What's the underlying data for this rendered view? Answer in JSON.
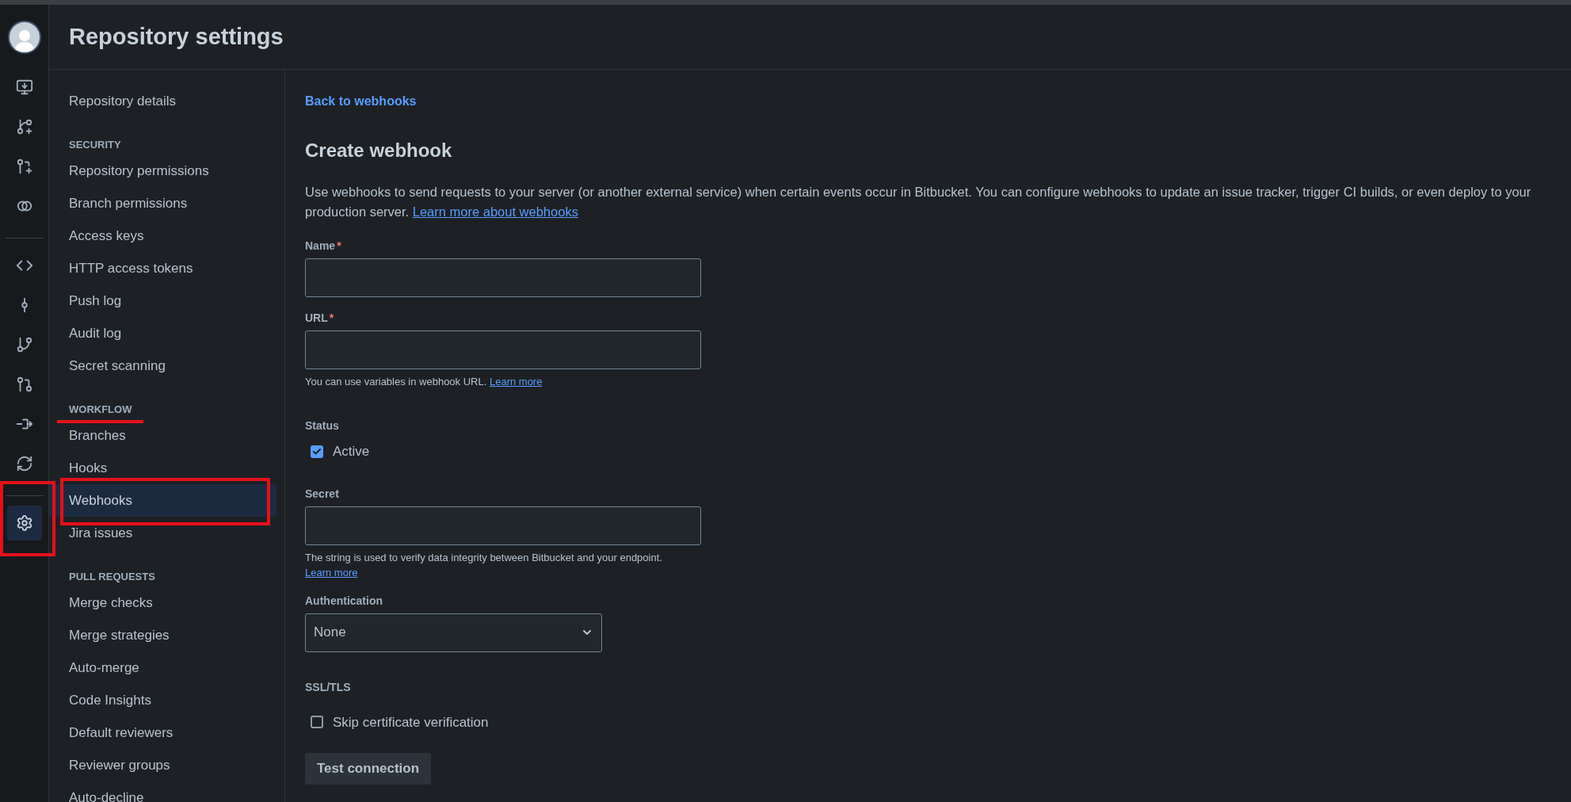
{
  "header": {
    "title": "Repository settings"
  },
  "rail": [
    {
      "selected": false
    },
    {
      "selected": false
    },
    {
      "selected": false
    },
    {
      "selected": false
    },
    {
      "selected": false
    },
    {
      "selected": false
    },
    {
      "selected": false
    },
    {
      "selected": false
    },
    {
      "selected": false
    },
    {
      "selected": false
    },
    {
      "selected": true
    }
  ],
  "sidebar": {
    "groups": [
      {
        "items": [
          {
            "label": "Repository details",
            "selected": false
          }
        ]
      },
      {
        "heading": "SECURITY",
        "items": [
          {
            "label": "Repository permissions",
            "selected": false
          },
          {
            "label": "Branch permissions",
            "selected": false
          },
          {
            "label": "Access keys",
            "selected": false
          },
          {
            "label": "HTTP access tokens",
            "selected": false
          },
          {
            "label": "Push log",
            "selected": false
          },
          {
            "label": "Audit log",
            "selected": false
          },
          {
            "label": "Secret scanning",
            "selected": false
          }
        ]
      },
      {
        "heading": "WORKFLOW",
        "items": [
          {
            "label": "Branches",
            "selected": false
          },
          {
            "label": "Hooks",
            "selected": false
          },
          {
            "label": "Webhooks",
            "selected": true
          },
          {
            "label": "Jira issues",
            "selected": false
          }
        ]
      },
      {
        "heading": "PULL REQUESTS",
        "items": [
          {
            "label": "Merge checks",
            "selected": false
          },
          {
            "label": "Merge strategies",
            "selected": false
          },
          {
            "label": "Auto-merge",
            "selected": false
          },
          {
            "label": "Code Insights",
            "selected": false
          },
          {
            "label": "Default reviewers",
            "selected": false
          },
          {
            "label": "Reviewer groups",
            "selected": false
          },
          {
            "label": "Auto-decline",
            "selected": false
          }
        ]
      }
    ]
  },
  "main": {
    "back_link": "Back to webhooks",
    "title": "Create webhook",
    "description": {
      "text": "Use webhooks to send requests to your server (or another external service) when certain events occur in Bitbucket. You can configure webhooks to update an issue tracker, trigger CI builds, or even deploy to your production server.",
      "link": "Learn more about webhooks"
    },
    "fields": [
      {
        "kind": "text",
        "label": "Name",
        "required": "*"
      },
      {
        "kind": "text",
        "label": "URL",
        "required": "*",
        "help": "You can use variables in webhook URL.",
        "help_link": "Learn more"
      },
      {
        "kind": "checkbox",
        "label": "Status",
        "option": "Active",
        "checked": true
      },
      {
        "kind": "text",
        "label": "Secret",
        "help": "The string is used to verify data integrity between Bitbucket and your endpoint.",
        "help_link": "Learn more"
      },
      {
        "kind": "select",
        "label": "Authentication",
        "value": "None"
      },
      {
        "kind": "checkbox",
        "label": "SSL/TLS",
        "option": "Skip certificate verification",
        "checked": false
      }
    ],
    "button": "Test connection"
  }
}
